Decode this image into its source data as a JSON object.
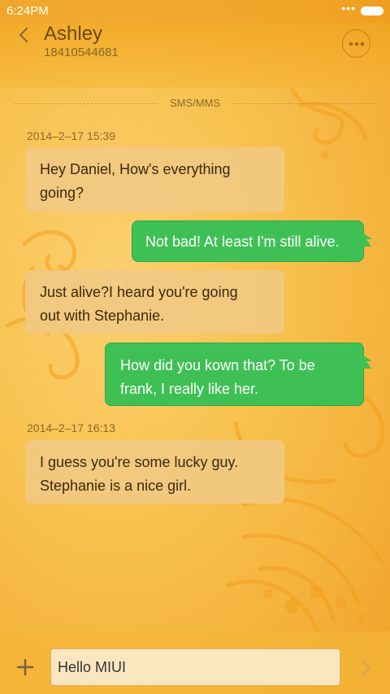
{
  "status_bar": {
    "time": "6:24PM",
    "dots": "•••"
  },
  "header": {
    "back_icon": "chevron-left-icon",
    "contact_name": "Ashley",
    "contact_number": "18410544681",
    "more_icon": "more-dots-icon"
  },
  "divider": {
    "label": "SMS/MMS"
  },
  "conversation": {
    "timestamps": [
      "2014–2–17 15:39",
      "2014–2–17 16:13"
    ],
    "messages": [
      {
        "direction": "incoming",
        "lines": [
          "Hey Daniel, How's everything",
          "going?"
        ]
      },
      {
        "direction": "outgoing",
        "lines": [
          "Not bad! At least I'm still alive."
        ]
      },
      {
        "direction": "incoming",
        "lines": [
          "Just  alive?I heard you're going",
          "out with Stephanie."
        ]
      },
      {
        "direction": "outgoing",
        "lines": [
          "How did you kown that? To be",
          "frank, I really like her."
        ]
      },
      {
        "direction": "incoming",
        "lines": [
          "I guess you're some lucky guy.",
          "Stephanie is a nice girl."
        ]
      }
    ]
  },
  "composer": {
    "add_icon": "plus-icon",
    "input_value": "Hello MIUI",
    "send_icon": "chevron-right-icon"
  },
  "colors": {
    "outgoing_bubble": "#3fc055",
    "incoming_bubble": "#f1c982",
    "background": "#f8c24f"
  }
}
